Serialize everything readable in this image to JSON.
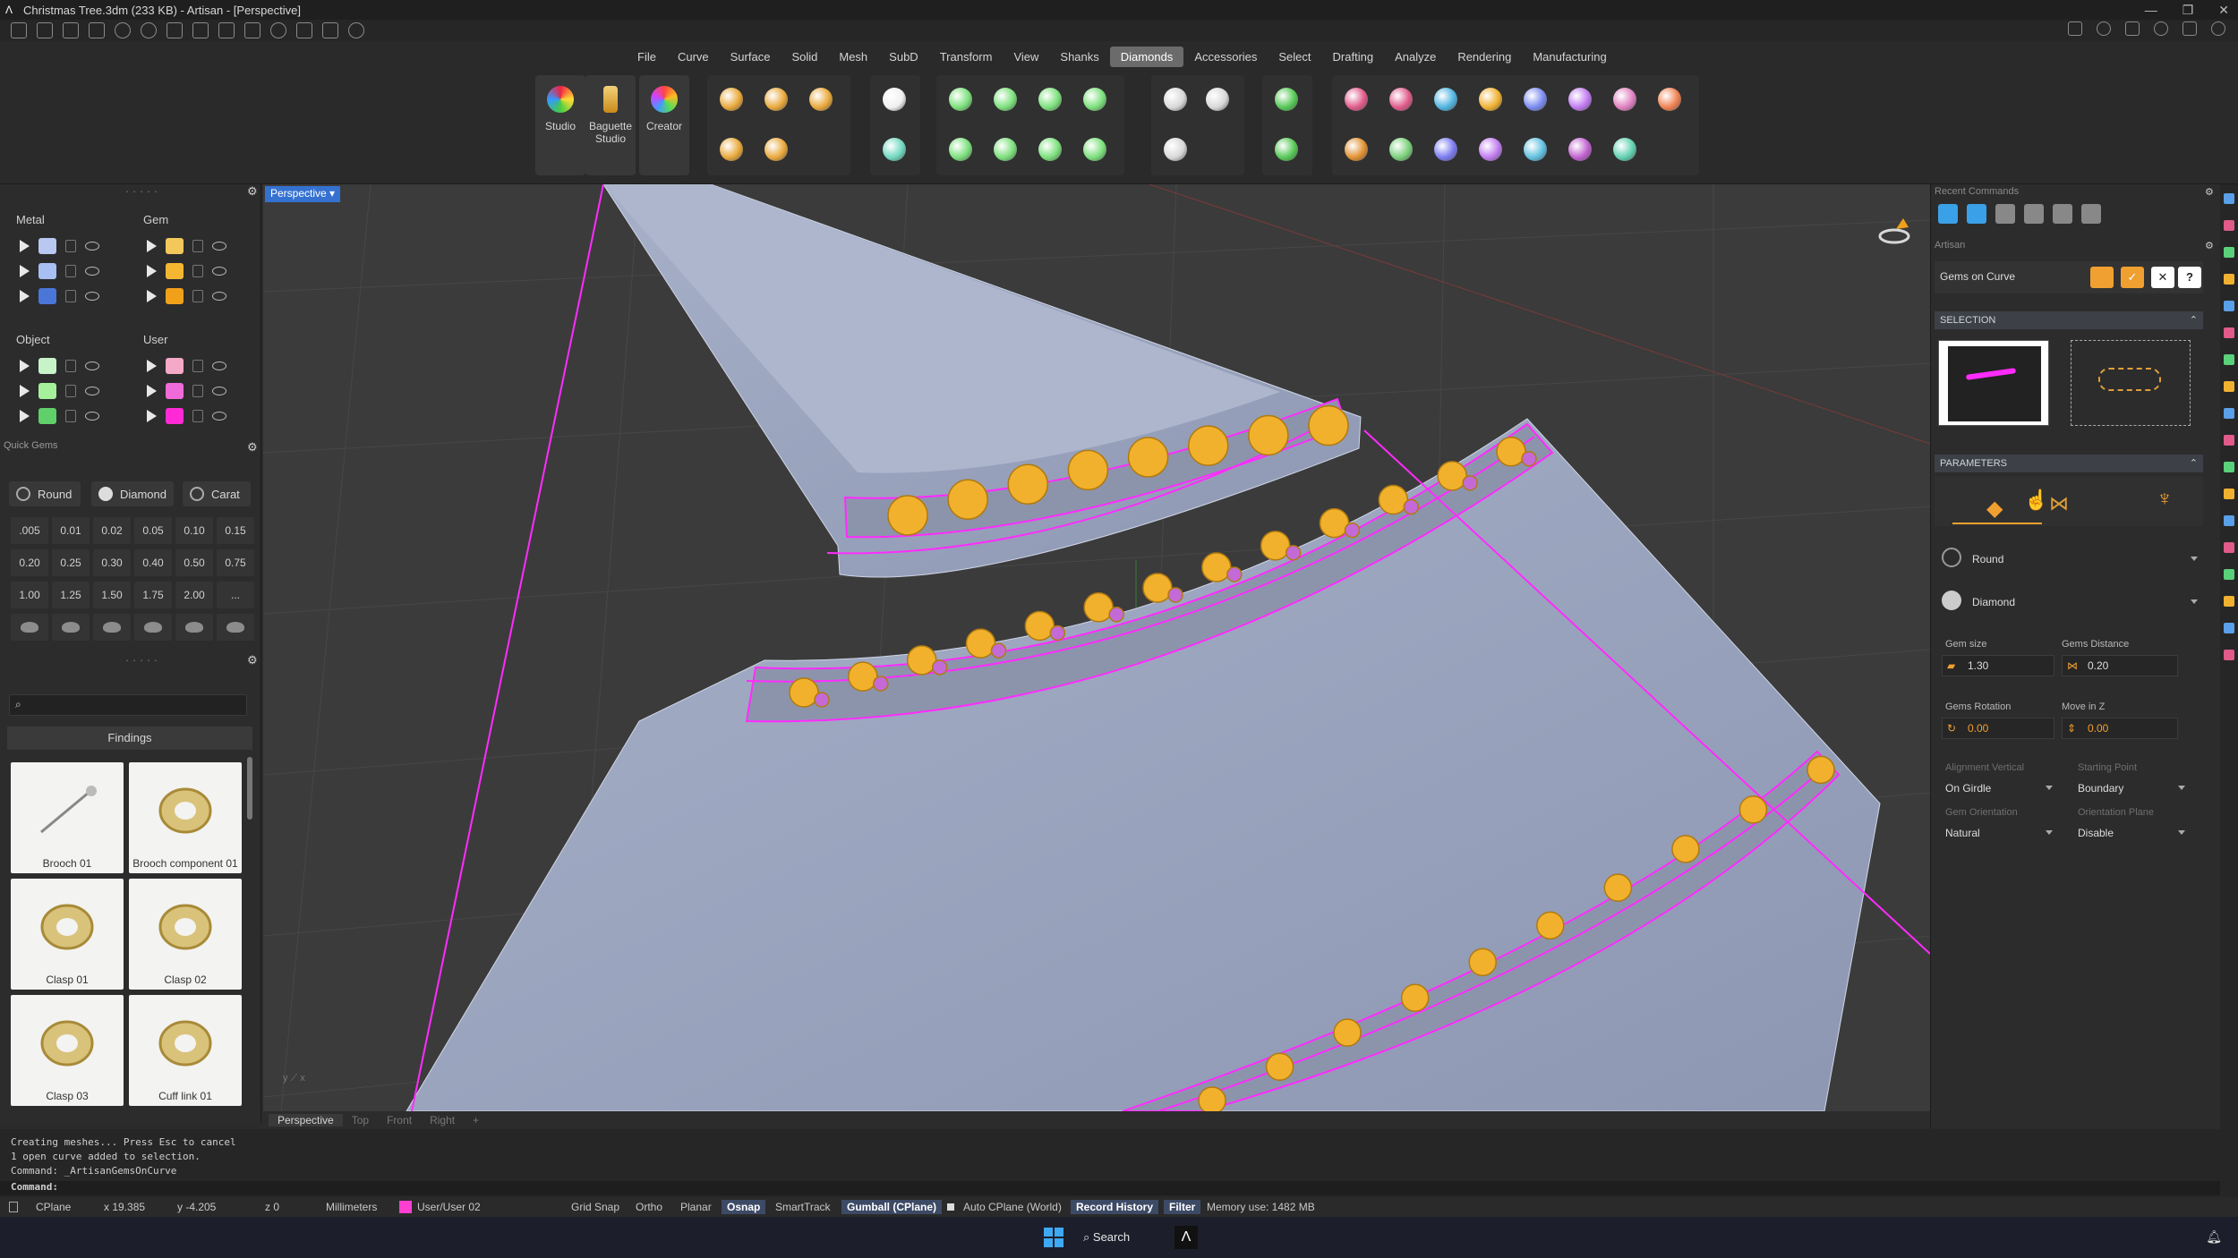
{
  "window": {
    "title": "Christmas Tree.3dm (233 KB) - Artisan - [Perspective]"
  },
  "menu": [
    "File",
    "Curve",
    "Surface",
    "Solid",
    "Mesh",
    "SubD",
    "Transform",
    "View",
    "Shanks",
    "Diamonds",
    "Accessories",
    "Select",
    "Drafting",
    "Analyze",
    "Rendering",
    "Manufacturing"
  ],
  "menu_active": "Diamonds",
  "toolbar": {
    "studio": "Studio",
    "baguette_line1": "Baguette",
    "baguette_line2": "Studio",
    "creator": "Creator"
  },
  "left": {
    "metal_label": "Metal",
    "gem_label": "Gem",
    "object_label": "Object",
    "user_label": "User",
    "metal_colors": [
      "#b9c8f0",
      "#a7bff2",
      "#4a76d8"
    ],
    "gem_colors": [
      "#f2c85b",
      "#f5b731",
      "#f0a019"
    ],
    "object_colors": [
      "#c7f3c8",
      "#a6f09c",
      "#5fd06a"
    ],
    "user_colors": [
      "#f4a9c8",
      "#f06ad9",
      "#ff2ad6"
    ],
    "quick_gems_label": "Quick Gems",
    "shape_round": "Round",
    "shape_diamond": "Diamond",
    "carat_label": "Carat",
    "carats": [
      ".005",
      "0.01",
      "0.02",
      "0.05",
      "0.10",
      "0.15",
      "0.20",
      "0.25",
      "0.30",
      "0.40",
      "0.50",
      "0.75",
      "1.00",
      "1.25",
      "1.50",
      "1.75",
      "2.00",
      "..."
    ],
    "findings_label": "Findings",
    "tiles": [
      "Brooch 01",
      "Brooch component 01",
      "Clasp 01",
      "Clasp 02",
      "Clasp 03",
      "Cuff link 01"
    ]
  },
  "viewport": {
    "label": "Perspective",
    "tabs": [
      "Perspective",
      "Top",
      "Front",
      "Right",
      "+"
    ]
  },
  "right": {
    "recent_commands": "Recent Commands",
    "artisan": "Artisan",
    "command_name": "Gems on Curve",
    "selection": "SELECTION",
    "parameters": "PARAMETERS",
    "shape": "Round",
    "material": "Diamond",
    "gem_size_label": "Gem size",
    "gem_size": "1.30",
    "gems_distance_label": "Gems Distance",
    "gems_distance": "0.20",
    "gems_rotation_label": "Gems Rotation",
    "gems_rotation": "0.00",
    "move_z_label": "Move in Z",
    "move_z": "0.00",
    "alignment_vertical_label": "Alignment Vertical",
    "alignment_vertical": "On Girdle",
    "starting_point_label": "Starting Point",
    "starting_point": "Boundary",
    "gem_orientation_label": "Gem Orientation",
    "gem_orientation": "Natural",
    "orientation_plane_label": "Orientation Plane",
    "orientation_plane": "Disable"
  },
  "command": {
    "lines": [
      "Creating meshes... Press Esc to cancel",
      "1 open curve added to selection.",
      "Command: _ArtisanGemsOnCurve"
    ],
    "prompt": "Command:"
  },
  "status": {
    "cplane": "CPlane",
    "x": "x 19.385",
    "y": "y -4.205",
    "z": "z 0",
    "units": "Millimeters",
    "layer": "User/User 02",
    "grid_snap": "Grid Snap",
    "ortho": "Ortho",
    "planar": "Planar",
    "osnap": "Osnap",
    "smarttrack": "SmartTrack",
    "gumball": "Gumball (CPlane)",
    "auto_cplane": "Auto CPlane (World)",
    "record_history": "Record History",
    "filter": "Filter",
    "memory": "Memory use: 1482 MB"
  },
  "taskbar": {
    "search": "Search"
  }
}
